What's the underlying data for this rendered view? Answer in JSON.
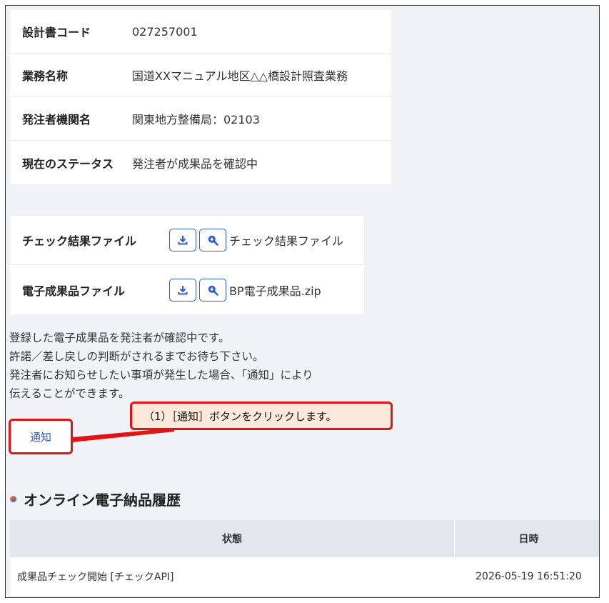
{
  "info": [
    {
      "label": "設計書コード",
      "value": "027257001"
    },
    {
      "label": "業務名称",
      "value": "国道XXマニュアル地区△△橋設計照査業務"
    },
    {
      "label": "発注者機関名",
      "value": "関東地方整備局：02103"
    },
    {
      "label": "現在のステータス",
      "value": "発注者が成果品を確認中"
    }
  ],
  "files": [
    {
      "label": "チェック結果ファイル",
      "name": "チェック結果ファイル"
    },
    {
      "label": "電子成果品ファイル",
      "name": "BP電子成果品.zip"
    }
  ],
  "message": [
    "登録した電子成果品を発注者が確認中です。",
    "許諾／差し戻しの判断がされるまでお待ち下さい。",
    "発注者にお知らせしたい事項が発生した場合、「通知」により",
    "伝えることができます。"
  ],
  "notify_label": "通知",
  "callout_text": "（1）［通知］ボタンをクリックします。",
  "history": {
    "title": "オンライン電子納品履歴",
    "col_status": "状態",
    "col_date": "日時",
    "rows": [
      {
        "status": "成果品チェック開始 [チェックAPI]",
        "date": "2026-05-19 16:51:20"
      }
    ]
  },
  "colors": {
    "accent": "#2d5bd6",
    "highlight": "#e01414",
    "callout_bg": "#fce9dc"
  },
  "icons": [
    "download-icon",
    "zoom-in-icon",
    "status-dot-icon"
  ]
}
